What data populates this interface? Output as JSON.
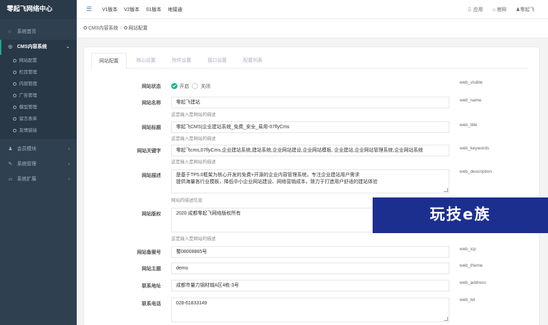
{
  "brand": "零起飞网络中心",
  "sidebar": {
    "items": [
      {
        "icon": "circle-icon",
        "glyph": "○",
        "label": "系统首页"
      },
      {
        "icon": "gear-icon",
        "glyph": "◎",
        "label": "CMS内容系统",
        "caret": "⌄"
      },
      {
        "icon": "users-icon",
        "glyph": "♟",
        "label": "会员模块",
        "caret": "‹"
      },
      {
        "icon": "wrench-icon",
        "glyph": "✎",
        "label": "系统管理",
        "caret": "‹"
      },
      {
        "icon": "plug-icon",
        "glyph": "⚏",
        "label": "系统扩展",
        "caret": "‹"
      }
    ],
    "sub_items": [
      "网站配置",
      "栏目管理",
      "内容管理",
      "广告管理",
      "模型管理",
      "留言表单",
      "友情链接"
    ]
  },
  "topbar": {
    "menu_icon": "☰",
    "links": [
      "V1版本",
      "V2版本",
      "S1版本",
      "地接通"
    ],
    "right": [
      {
        "icon": "app-icon",
        "glyph": "⇩",
        "label": "应用"
      },
      {
        "icon": "home-icon",
        "glyph": "⌂",
        "label": "官网"
      },
      {
        "icon": "user-icon",
        "glyph": "♟",
        "label": "零起飞"
      }
    ]
  },
  "breadcrumb": [
    "CMS内容系统",
    "网站配置"
  ],
  "tabs": [
    "网站配置",
    "核心设置",
    "附件设置",
    "接口设置",
    "配置列表"
  ],
  "form": {
    "status": {
      "label": "网站状态",
      "on": "开启",
      "off": "关闭",
      "key": "web_visible"
    },
    "name": {
      "label": "网站名称",
      "value": "零起飞建站",
      "hint": "这是输入是网站的描述",
      "key": "web_name"
    },
    "title": {
      "label": "网站标题",
      "value": "零起飞CMS|企业建站系统_免费_安全_易用-07flyCms",
      "hint": "这是输入是网站的描述",
      "key": "web_title"
    },
    "keywords": {
      "label": "网站关键字",
      "value": "零起飞cms,07flyCms,企业建站系统,建站系统,企业网站建设,企业网站模板, 企业建站,企业网站管理系统,企业网站系统",
      "hint": "这是输入是网站的描述",
      "key": "web_keywords"
    },
    "description": {
      "label": "网站描述",
      "value_line1": "是基于TP5.0框架为核心开发的免费+开源的企业内容管理系统，专注企业建站用户需求",
      "value_line2": "提供海量各行业模板，降低中小企业网站建设、网络营销成本，致力于打造用户舒适的建站体验",
      "hint": "网站的描述信息",
      "key": "web_description"
    },
    "copyright": {
      "label": "网站版权",
      "value": "2020 成都零起飞网络版权所有",
      "hint": "这是输入是网站的描述"
    },
    "icp": {
      "label": "网站备案号",
      "value": "蜀08008865号",
      "key": "web_icp"
    },
    "theme": {
      "label": "网站主题",
      "value": "demo",
      "key": "web_theme"
    },
    "address": {
      "label": "联系地址",
      "value": "成都市量力钢材城A区4栋-3号",
      "key": "web_address"
    },
    "tel": {
      "label": "联系电话",
      "value": "028-61833149",
      "key": "web_tel"
    }
  },
  "watermark": "玩技e族"
}
